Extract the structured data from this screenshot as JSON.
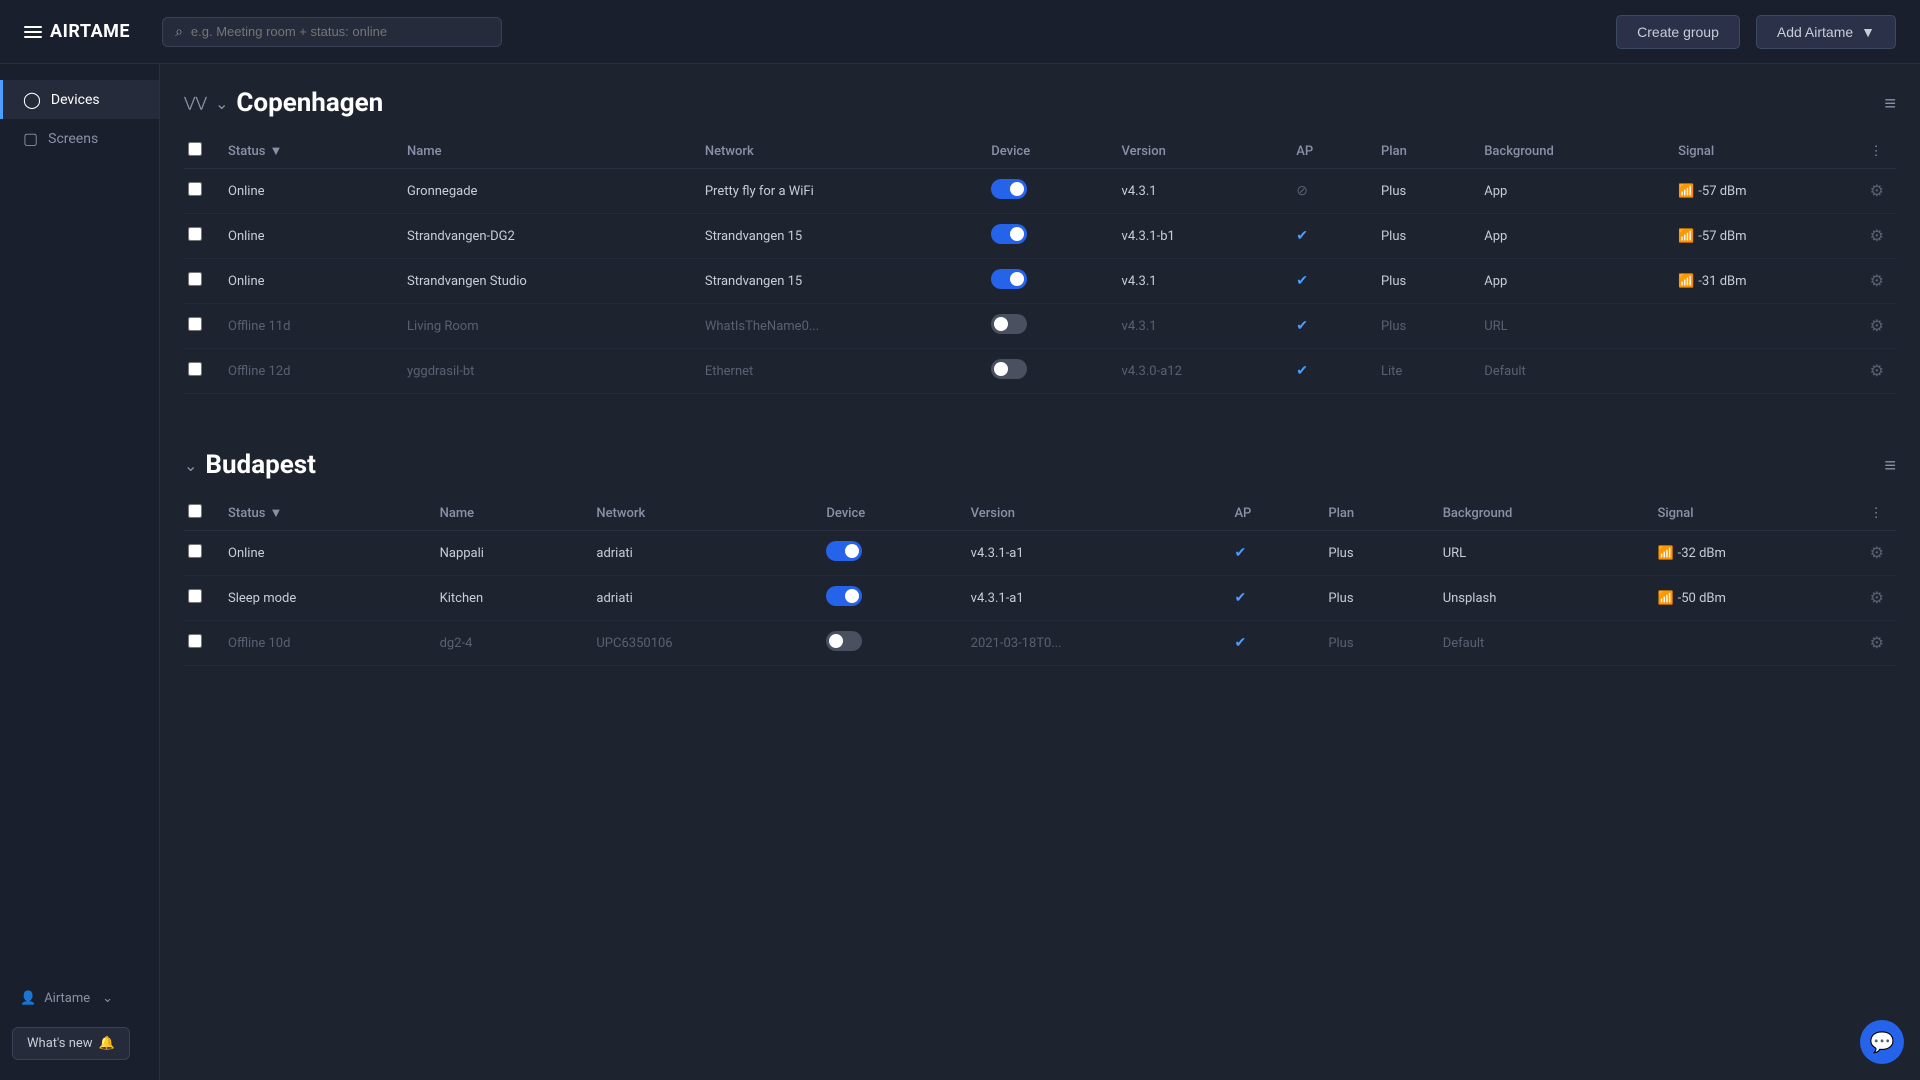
{
  "topbar": {
    "logo_text": "AIRTAME",
    "search_placeholder": "e.g. Meeting room + status: online",
    "create_group_label": "Create group",
    "add_airtame_label": "Add Airtame"
  },
  "sidebar": {
    "devices_label": "Devices",
    "screens_label": "Screens"
  },
  "footer": {
    "airtame_label": "Airtame",
    "whats_new_label": "What's new"
  },
  "groups": [
    {
      "id": "copenhagen",
      "name": "Copenhagen",
      "columns": {
        "status": "Status",
        "name": "Name",
        "network": "Network",
        "device": "Device",
        "version": "Version",
        "ap": "AP",
        "plan": "Plan",
        "background": "Background",
        "signal": "Signal"
      },
      "devices": [
        {
          "status": "Online",
          "status_class": "online",
          "toggle": "on",
          "name": "Gronnegade",
          "network": "Pretty fly for a WiFi",
          "version": "v4.3.1",
          "ap": "slash",
          "plan": "Plus",
          "background": "App",
          "signal": "-57 dBm",
          "has_signal": true
        },
        {
          "status": "Online",
          "status_class": "online",
          "toggle": "on",
          "name": "Strandvangen-DG2",
          "network": "Strandvangen 15",
          "version": "v4.3.1-b1",
          "ap": "check",
          "plan": "Plus",
          "background": "App",
          "signal": "-57 dBm",
          "has_signal": true
        },
        {
          "status": "Online",
          "status_class": "online",
          "toggle": "on",
          "name": "Strandvangen Studio",
          "network": "Strandvangen 15",
          "version": "v4.3.1",
          "ap": "check",
          "plan": "Plus",
          "background": "App",
          "signal": "-31 dBm",
          "has_signal": true
        },
        {
          "status": "Offline 11d",
          "status_class": "offline",
          "toggle": "off",
          "name": "Living Room",
          "network": "WhatIsTheName0...",
          "version": "v4.3.1",
          "ap": "check",
          "plan": "Plus",
          "background": "URL",
          "signal": "",
          "has_signal": false
        },
        {
          "status": "Offline 12d",
          "status_class": "offline",
          "toggle": "off",
          "name": "yggdrasil-bt",
          "network": "Ethernet",
          "version": "v4.3.0-a12",
          "ap": "check",
          "plan": "Lite",
          "background": "Default",
          "signal": "",
          "has_signal": false
        }
      ]
    },
    {
      "id": "budapest",
      "name": "Budapest",
      "columns": {
        "status": "Status",
        "name": "Name",
        "network": "Network",
        "device": "Device",
        "version": "Version",
        "ap": "AP",
        "plan": "Plan",
        "background": "Background",
        "signal": "Signal"
      },
      "devices": [
        {
          "status": "Online",
          "status_class": "online",
          "toggle": "on",
          "name": "Nappali",
          "network": "adriati",
          "version": "v4.3.1-a1",
          "ap": "check",
          "plan": "Plus",
          "background": "URL",
          "signal": "-32 dBm",
          "has_signal": true
        },
        {
          "status": "Sleep mode",
          "status_class": "sleep",
          "toggle": "on",
          "name": "Kitchen",
          "network": "adriati",
          "version": "v4.3.1-a1",
          "ap": "check",
          "plan": "Plus",
          "background": "Unsplash",
          "signal": "-50 dBm",
          "has_signal": true
        },
        {
          "status": "Offline 10d",
          "status_class": "offline",
          "toggle": "off",
          "name": "dg2-4",
          "network": "UPC6350106",
          "version": "2021-03-18T0...",
          "ap": "check",
          "plan": "Plus",
          "background": "Default",
          "signal": "",
          "has_signal": false
        }
      ]
    }
  ]
}
